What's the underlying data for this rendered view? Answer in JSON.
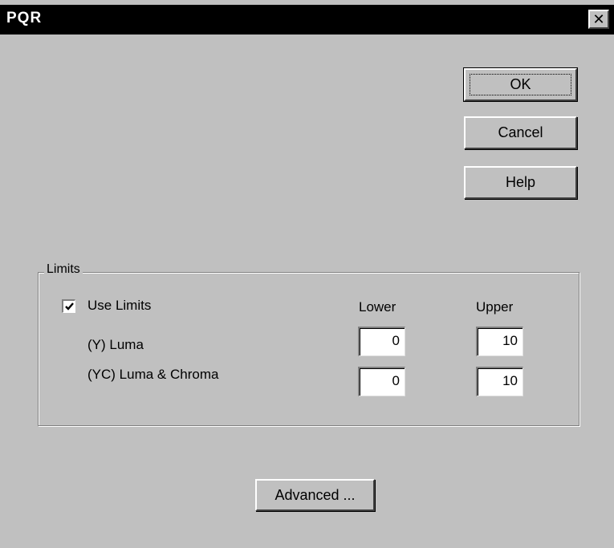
{
  "window": {
    "title": "PQR",
    "close_glyph": "✕"
  },
  "buttons": {
    "ok": "OK",
    "cancel": "Cancel",
    "help": "Help",
    "advanced": "Advanced ..."
  },
  "limits": {
    "group_label": "Limits",
    "use_limits_label": "Use Limits",
    "use_limits_checked": true,
    "col_lower": "Lower",
    "col_upper": "Upper",
    "rows": [
      {
        "label": "(Y) Luma",
        "lower": "0",
        "upper": "10"
      },
      {
        "label": "(YC) Luma & Chroma",
        "lower": "0",
        "upper": "10"
      }
    ]
  }
}
